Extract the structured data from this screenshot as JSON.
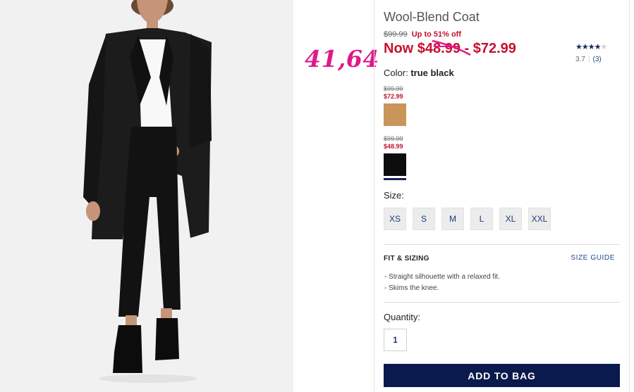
{
  "product": {
    "title": "Wool-Blend Coat",
    "original_price": "$99.99",
    "discount_text": "Up to 51% off",
    "now_prefix": "Now",
    "now_low": "$48.99",
    "now_dash": " - ",
    "now_high": "$72.99"
  },
  "annotation": {
    "text": "41,64",
    "color": "#e0198a"
  },
  "rating": {
    "value": "3.7",
    "count": "(3)",
    "stars_filled": 3.7,
    "stars_total": 5
  },
  "color_selector": {
    "label": "Color:",
    "selected": "true black",
    "swatches": [
      {
        "old_price": "$99.99",
        "new_price": "$72.99",
        "color": "#c9955a",
        "name": "camel"
      },
      {
        "old_price": "$99.99",
        "new_price": "$48.99",
        "color": "#0d0d0d",
        "name": "true black",
        "selected": true
      }
    ]
  },
  "size_selector": {
    "label": "Size:",
    "options": [
      "XS",
      "S",
      "M",
      "L",
      "XL",
      "XXL"
    ]
  },
  "fit": {
    "heading": "FIT & SIZING",
    "size_guide_link": "SIZE GUIDE",
    "bullets": [
      "- Straight silhouette with a relaxed fit.",
      "- Skims the knee."
    ]
  },
  "quantity": {
    "label": "Quantity:",
    "value": "1"
  },
  "cta": {
    "add_to_bag": "ADD TO BAG"
  },
  "colors": {
    "sale_red": "#c8102e",
    "navy": "#0b1a4c",
    "link_blue": "#1b4a8a"
  }
}
